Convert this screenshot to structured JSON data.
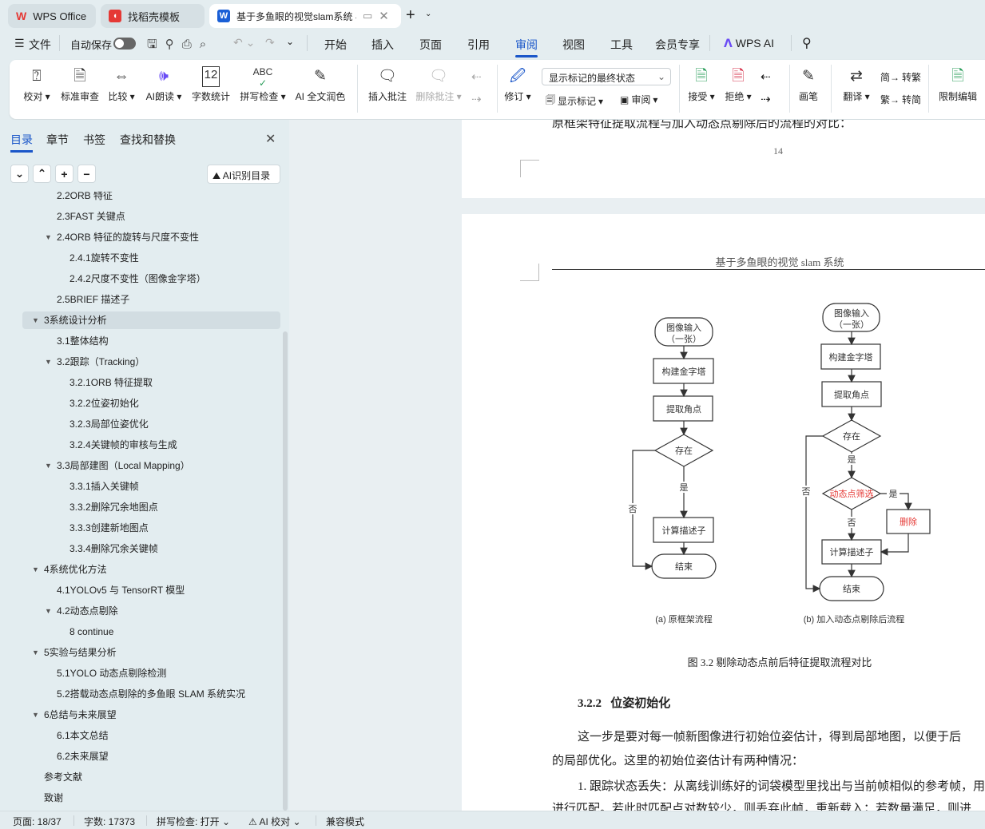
{
  "tabs": [
    {
      "label": "WPS Office",
      "icon": "wps-logo-icon"
    },
    {
      "label": "找稻壳模板",
      "icon": "docer-icon"
    },
    {
      "label": "基于多鱼眼的视觉slam系统 与",
      "icon": "word-doc-icon",
      "active": true
    }
  ],
  "menu": {
    "file": "文件",
    "autosave": "自动保存",
    "autosave_on": false,
    "items": [
      "开始",
      "插入",
      "页面",
      "引用",
      "审阅",
      "视图",
      "工具",
      "会员专享"
    ],
    "active": "审阅",
    "wps_ai": "WPS AI"
  },
  "ribbon": {
    "proofread": "校对",
    "standard_review": "标准审查",
    "compare": "比较",
    "ai_read": "AI朗读",
    "word_count": "字数统计",
    "spell_check": "拼写检查",
    "ai_polish": "AI 全文润色",
    "insert_comment": "插入批注",
    "delete_comment": "删除批注",
    "revise": "修订",
    "markup_select": "显示标记的最终状态",
    "show_markup": "显示标记",
    "review": "审阅",
    "accept": "接受",
    "reject": "拒绝",
    "pen": "画笔",
    "translate": "翻译",
    "to_traditional": "转繁",
    "to_simplified": "转简",
    "restrict_edit": "限制编辑"
  },
  "sidebar": {
    "tabs": [
      "目录",
      "章节",
      "书签",
      "查找和替换"
    ],
    "active_tab": "目录",
    "ai_toc": "AI识别目录",
    "toc": [
      {
        "label": "2.2ORB 特征",
        "level": 2
      },
      {
        "label": "2.3FAST 关键点",
        "level": 2
      },
      {
        "label": "2.4ORB 特征的旋转与尺度不变性",
        "level": 2,
        "expanded": true
      },
      {
        "label": "2.4.1旋转不变性",
        "level": 3
      },
      {
        "label": "2.4.2尺度不变性（图像金字塔）",
        "level": 3
      },
      {
        "label": "2.5BRIEF 描述子",
        "level": 2
      },
      {
        "label": "3系统设计分析",
        "level": 1,
        "expanded": true,
        "selected": true
      },
      {
        "label": "3.1整体结构",
        "level": 2
      },
      {
        "label": "3.2跟踪（Tracking）",
        "level": 2,
        "expanded": true
      },
      {
        "label": "3.2.1ORB 特征提取",
        "level": 3
      },
      {
        "label": "3.2.2位姿初始化",
        "level": 3
      },
      {
        "label": "3.2.3局部位姿优化",
        "level": 3
      },
      {
        "label": "3.2.4关键帧的审核与生成",
        "level": 3
      },
      {
        "label": "3.3局部建图（Local Mapping）",
        "level": 2,
        "expanded": true
      },
      {
        "label": "3.3.1插入关键帧",
        "level": 3
      },
      {
        "label": "3.3.2删除冗余地图点",
        "level": 3
      },
      {
        "label": "3.3.3创建新地图点",
        "level": 3
      },
      {
        "label": "3.3.4删除冗余关键帧",
        "level": 3
      },
      {
        "label": "4系统优化方法",
        "level": 1,
        "expanded": true
      },
      {
        "label": "4.1YOLOv5 与 TensorRT 模型",
        "level": 2
      },
      {
        "label": "4.2动态点剔除",
        "level": 2,
        "expanded": true
      },
      {
        "label": "8 continue",
        "level": 3
      },
      {
        "label": "5实验与结果分析",
        "level": 1,
        "expanded": true
      },
      {
        "label": "5.1YOLO 动态点剔除检测",
        "level": 2
      },
      {
        "label": "5.2搭载动态点剔除的多鱼眼 SLAM 系统实况",
        "level": 2
      },
      {
        "label": "6总结与未来展望",
        "level": 1,
        "expanded": true
      },
      {
        "label": "6.1本文总结",
        "level": 2
      },
      {
        "label": "6.2未来展望",
        "level": 2
      },
      {
        "label": "参考文献",
        "level": 1,
        "leaf": true
      },
      {
        "label": "致谢",
        "level": 1,
        "leaf": true
      }
    ]
  },
  "doc": {
    "page1_line": "原框架特征提取流程与加入动态点剔除后的流程的对比：",
    "page_number": "14",
    "header": "基于多鱼眼的视觉 slam 系统",
    "flow_a": {
      "input": "图像输入",
      "input2": "（一张）",
      "pyramid": "构建金字塔",
      "corners": "提取角点",
      "exists": "存在",
      "yes": "是",
      "no": "否",
      "descriptor": "计算描述子",
      "end": "结束",
      "caption": "(a) 原框架流程"
    },
    "flow_b": {
      "input": "图像输入",
      "input2": "（一张）",
      "pyramid": "构建金字塔",
      "corners": "提取角点",
      "exists": "存在",
      "yes": "是",
      "no": "否",
      "filter": "动态点筛选",
      "filter_yes": "是",
      "filter_no": "否",
      "delete": "删除",
      "descriptor": "计算描述子",
      "end": "结束",
      "caption": "(b) 加入动态点剔除后流程"
    },
    "highlight_color": "#e53935",
    "figure_caption": "图 3.2 剔除动态点前后特征提取流程对比",
    "section_num": "3.2.2",
    "section_title": "位姿初始化",
    "paragraphs": [
      "这一步是要对每一帧新图像进行初始位姿估计，得到局部地图，以便于后",
      "的局部优化。这里的初始位姿估计有两种情况：",
      "1. 跟踪状态丢失：从离线训练好的词袋模型里找出与当前帧相似的参考帧，用",
      "进行匹配。若此时匹配点对数较少，则丢弃此帧，重新载入；若数量满足，则进"
    ]
  },
  "status": {
    "page": "页面: 18/37",
    "words": "字数: 17373",
    "spell": "拼写检查: 打开",
    "ai_proof": "AI 校对",
    "compat": "兼容模式"
  }
}
